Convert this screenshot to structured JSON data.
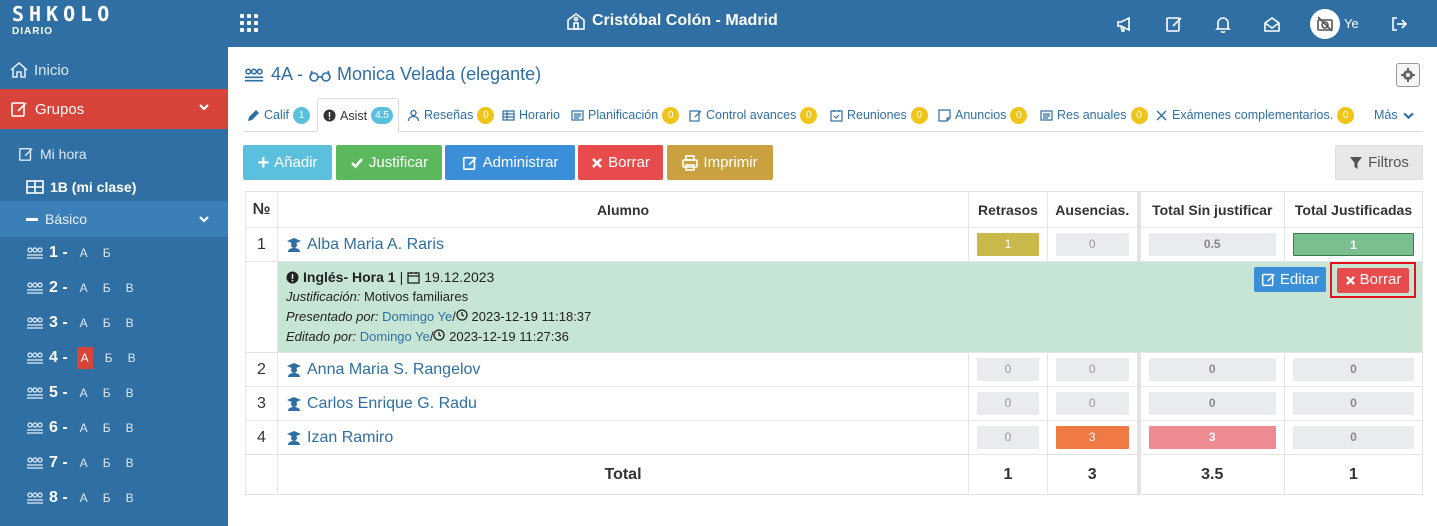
{
  "header": {
    "logo_main": "SHKOLO",
    "logo_sub": "DIARIO",
    "school": "Cristóbal Colón - Madrid",
    "user": "Ye"
  },
  "sidebar": {
    "inicio": "Inicio",
    "grupos": "Grupos",
    "mi_hora": "Mi hora",
    "my_class": "1B (mi clase)",
    "basico": "Básico",
    "grades": [
      {
        "num": "1 -",
        "letters": [
          "А",
          "Б"
        ]
      },
      {
        "num": "2 -",
        "letters": [
          "А",
          "Б",
          "В"
        ]
      },
      {
        "num": "3 -",
        "letters": [
          "А",
          "Б",
          "В"
        ]
      },
      {
        "num": "4 -",
        "letters": [
          "А",
          "Б",
          "В"
        ],
        "active": "А"
      },
      {
        "num": "5 -",
        "letters": [
          "А",
          "Б",
          "В"
        ]
      },
      {
        "num": "6 -",
        "letters": [
          "А",
          "Б",
          "В"
        ]
      },
      {
        "num": "7 -",
        "letters": [
          "А",
          "Б",
          "В"
        ]
      },
      {
        "num": "8 -",
        "letters": [
          "А",
          "Б",
          "В"
        ]
      }
    ]
  },
  "page": {
    "class": "4A -",
    "teacher": "Monica Velada (elegante)"
  },
  "tabs": [
    {
      "label": "Calif",
      "badge": "1"
    },
    {
      "label": "Asist",
      "badge": "4.5"
    },
    {
      "label": "Reseñas",
      "badge": "0"
    },
    {
      "label": "Horario"
    },
    {
      "label": "Planificación",
      "badge": "0"
    },
    {
      "label": "Control avances",
      "badge": "0"
    },
    {
      "label": "Reuniones",
      "badge": "0"
    },
    {
      "label": "Anuncios",
      "badge": "0"
    },
    {
      "label": "Res anuales",
      "badge": "0"
    },
    {
      "label": "Exámenes complementarios.",
      "badge": "0"
    },
    {
      "label": "Más"
    }
  ],
  "toolbar": {
    "add": "Añadir",
    "justify": "Justificar",
    "admin": "Administrar",
    "delete": "Borrar",
    "print": "Imprimir",
    "filters": "Filtros"
  },
  "table": {
    "headers": [
      "№",
      "Alumno",
      "Retrasos",
      "Ausencias.",
      "Total Sin justificar",
      "Total Justificadas"
    ],
    "rows": [
      {
        "num": "1",
        "name": "Alba Maria A. Raris",
        "retrasos": "1",
        "ausencias": "0",
        "sin_just": "0.5",
        "just": "1"
      },
      {
        "num": "2",
        "name": "Anna Maria S. Rangelov",
        "retrasos": "0",
        "ausencias": "0",
        "sin_just": "0",
        "just": "0"
      },
      {
        "num": "3",
        "name": "Carlos Enrique G. Radu",
        "retrasos": "0",
        "ausencias": "0",
        "sin_just": "0",
        "just": "0"
      },
      {
        "num": "4",
        "name": "Izan Ramiro",
        "retrasos": "0",
        "ausencias": "3",
        "sin_just": "3",
        "just": "0"
      }
    ],
    "detail": {
      "title": "Inglés- Hora 1",
      "sep": "|",
      "date": "19.12.2023",
      "just_label": "Justificación:",
      "just_value": "Motivos familiares",
      "pres_label": "Presentado por:",
      "pres_by": "Domingo Ye",
      "pres_time": "2023-12-19 11:18:37",
      "edit_label": "Editado por:",
      "edit_by": "Domingo Ye",
      "edit_time": "2023-12-19 11:27:36",
      "edit_btn": "Editar",
      "delete_btn": "Borrar"
    },
    "total": {
      "label": "Total",
      "retrasos": "1",
      "ausencias": "3",
      "sin_just": "3.5",
      "just": "1"
    }
  }
}
